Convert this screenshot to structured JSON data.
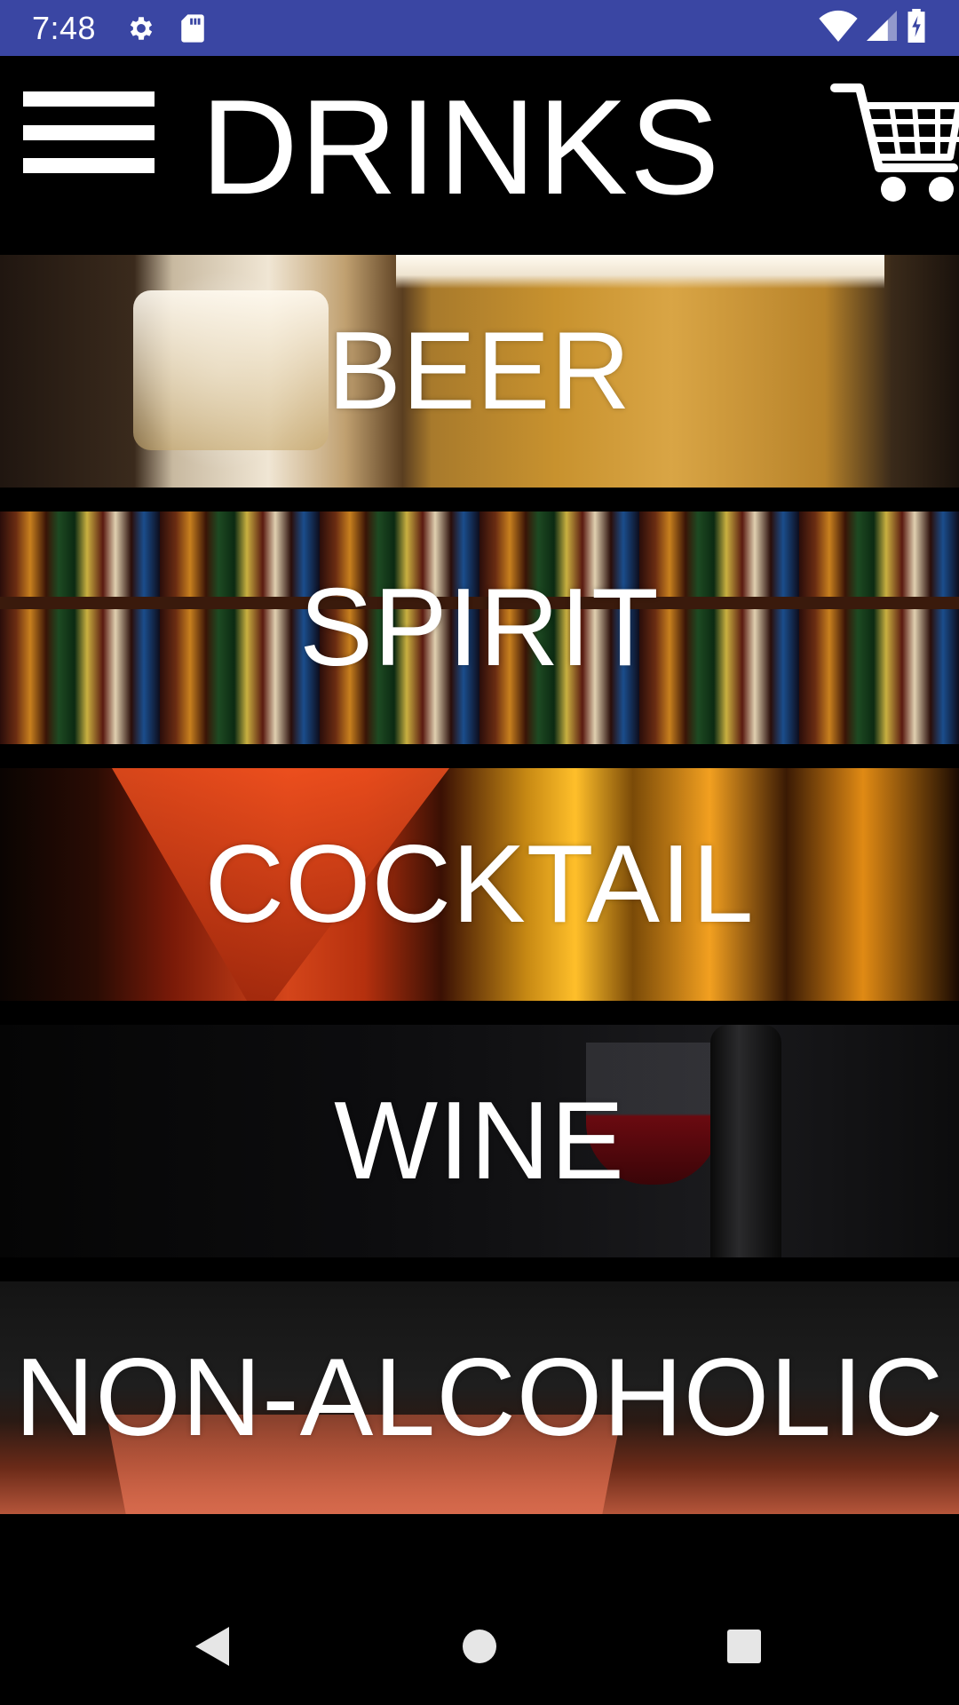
{
  "status_bar": {
    "time": "7:48",
    "icons": [
      "settings-icon",
      "sd-card-icon",
      "wifi-icon",
      "signal-icon",
      "battery-charging-icon"
    ],
    "background": "#3a46a3"
  },
  "header": {
    "title": "DRINKS",
    "menu_icon": "hamburger-menu-icon",
    "cart_icon": "shopping-cart-icon"
  },
  "categories": [
    {
      "label": "BEER"
    },
    {
      "label": "SPIRIT"
    },
    {
      "label": "COCKTAIL"
    },
    {
      "label": "WINE"
    },
    {
      "label": "NON-ALCOHOLIC"
    }
  ],
  "nav_bar": {
    "buttons": [
      "back-icon",
      "home-icon",
      "recents-icon"
    ]
  }
}
